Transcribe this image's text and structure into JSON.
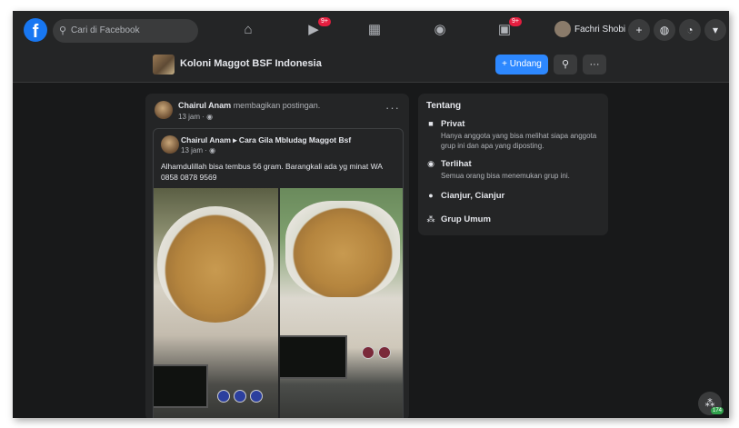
{
  "topbar": {
    "logo": "f",
    "search_placeholder": "Cari di Facebook",
    "nav": [
      {
        "name": "home-icon",
        "glyph": "⌂",
        "badge": ""
      },
      {
        "name": "watch-icon",
        "glyph": "▶",
        "badge": "9+"
      },
      {
        "name": "marketplace-icon",
        "glyph": "▦",
        "badge": ""
      },
      {
        "name": "groups-icon",
        "glyph": "◉",
        "badge": ""
      },
      {
        "name": "gaming-icon",
        "glyph": "▣",
        "badge": "9+"
      }
    ],
    "profile_name": "Fachri Shobi",
    "plus_glyph": "+",
    "messenger_glyph": "◍",
    "notifications_glyph": "◔",
    "menu_glyph": "▾"
  },
  "group": {
    "name": "Koloni Maggot BSF Indonesia",
    "invite_label": "+ Undang",
    "search_glyph": "⚲",
    "more_glyph": "···"
  },
  "post": {
    "author": "Chairul Anam",
    "action": " membagikan postingan.",
    "time": "13 jam · ◉",
    "more_glyph": "···",
    "shared": {
      "author": "Chairul Anam ▸ Cara Gila Mbludag Maggot Bsf",
      "time": "13 jam · ◉",
      "text": "Alhamdulillah bisa tembus 56 gram. Barangkali ada yg minat WA 0858 0878 9569"
    }
  },
  "about": {
    "title": "Tentang",
    "items": [
      {
        "icon": "lock-icon",
        "glyph": "🔒",
        "label": "Privat",
        "desc": "Hanya anggota yang bisa melihat siapa anggota grup ini dan apa yang diposting."
      },
      {
        "icon": "eye-icon",
        "glyph": "◉",
        "label": "Terlihat",
        "desc": "Semua orang bisa menemukan grup ini."
      },
      {
        "icon": "location-icon",
        "glyph": "⬤",
        "label": "Cianjur, Cianjur",
        "desc": ""
      },
      {
        "icon": "people-icon",
        "glyph": "⁂",
        "label": "Grup Umum",
        "desc": ""
      }
    ]
  },
  "fab": {
    "glyph": "⁂",
    "badge": "174"
  }
}
